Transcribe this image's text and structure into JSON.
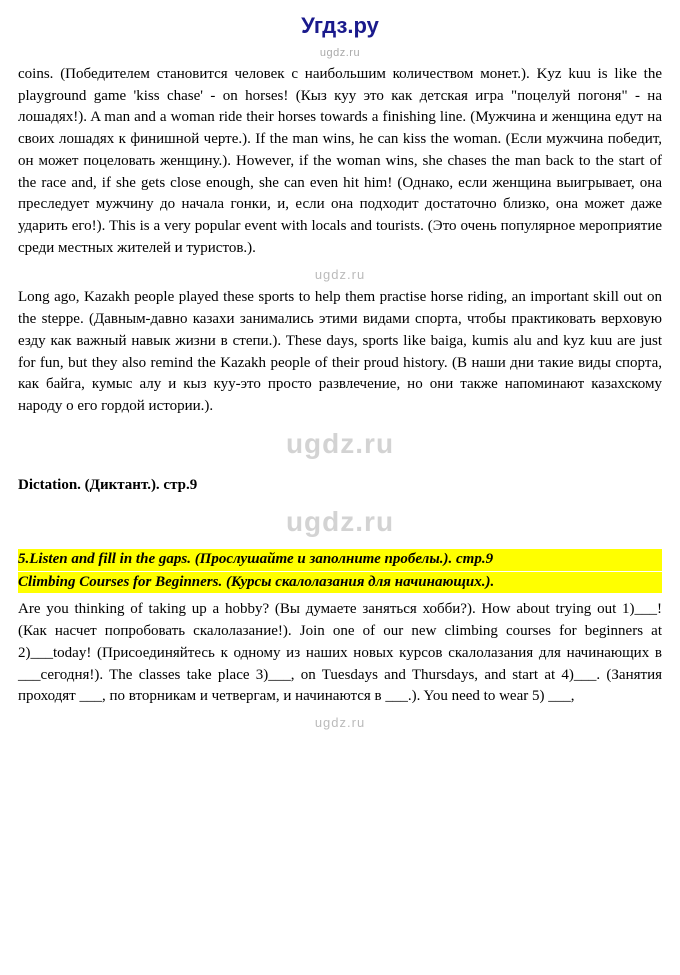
{
  "site": {
    "title": "Угдз.ру",
    "watermark": "ugdz.ru"
  },
  "content": {
    "paragraphs": [
      {
        "id": "p1",
        "text": "coins. (Победителем становится человек с наибольшим количеством монет.). Kyz kuu is like the playground game 'kiss chase' - on horses! (Кыз куу это как детская игра \"поцелуй погоня\" - на лошадях!). A man and a woman ride their horses towards a finishing line. (Мужчина и женщина едут на своих лошадях к финишной черте.). If the man wins, he can kiss the woman. (Если мужчина победит, он может поцеловать женщину.). However, if the woman wins, she chases the man back to the start of the race and, if she gets close enough, she can even hit him! (Однако, если женщина выигрывает, она преследует мужчину до начала гонки, и, если она подходит достаточно близко, она может даже ударить его!). This is a very popular event with locals and tourists. (Это очень популярное мероприятие среди местных жителей и туристов.)."
      },
      {
        "id": "p2",
        "text": "Long ago, Kazakh people played these sports to help them practise horse riding, an important skill out on the steppe. (Давным-давно казахи занимались этими видами спорта, чтобы практиковать верховую езду как важный навык жизни в степи.). These days, sports like baiga, kumis alu and kyz kuu are just for fun, but they also remind the Kazakh people of their proud history. (В наши дни такие виды спорта, как байга, кумыс алу и кыз куу-это просто развлечение, но они также напоминают казахскому народу о его гордой истории.)."
      }
    ],
    "dictation_heading": "Dictation. (Диктант.). стр.9",
    "task_heading_1": "5.Listen and fill in the gaps. (Прослушайте и заполните пробелы.). стр.9",
    "task_heading_2": "Climbing Courses for Beginners. (Курсы скалолазания для начинающих.).",
    "task_text_1": "Are you thinking of taking up a hobby? (Вы думаете заняться хобби?). How about trying out 1)___! (Как насчет попробовать скалолазание!).  Join one of our new climbing courses for beginners at 2)___today! (Присоединяйтесь к одному из наших новых курсов скалолазания для начинающих в ___сегодня!). The classes take place 3)___, on Tuesdays and Thursdays, and start at 4)___. (Занятия проходят ___, по вторникам и четвергам, и начинаются в ___.). You need to wear 5) ___,"
  }
}
